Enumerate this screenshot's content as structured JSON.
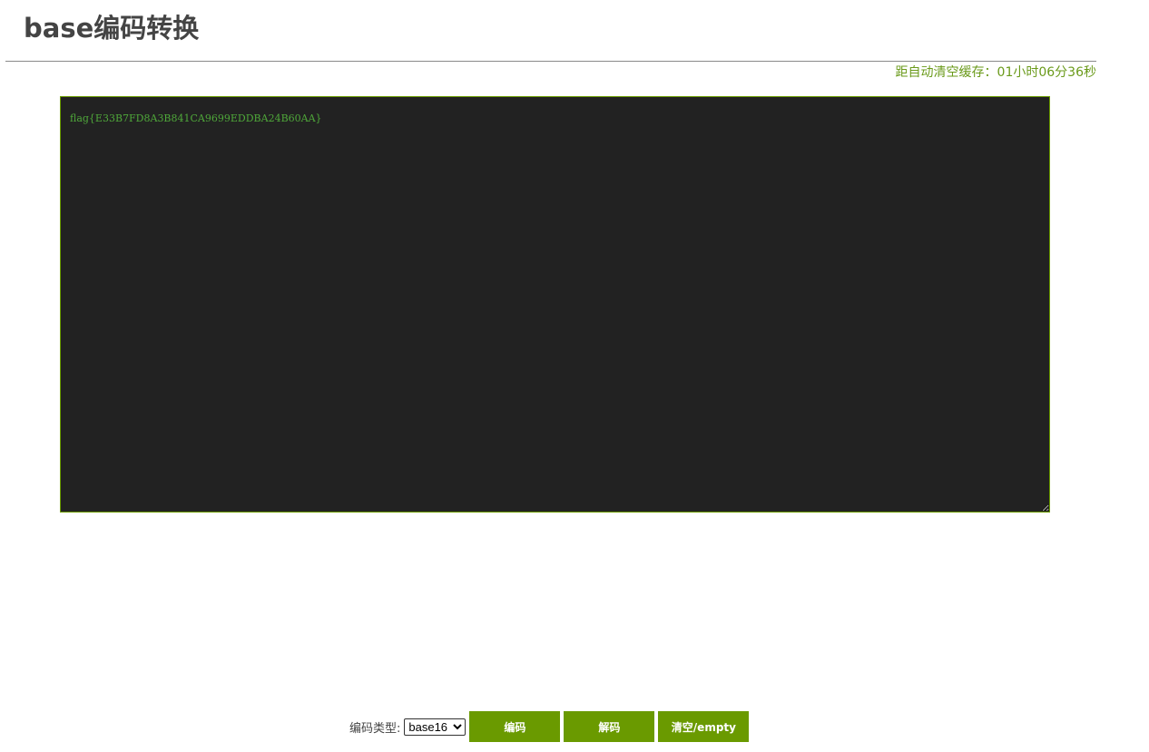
{
  "header": {
    "title": "base编码转换"
  },
  "timer": {
    "text": "距自动清空缓存：01小时06分36秒"
  },
  "editor": {
    "value": "flag{E33B7FD8A3B841CA9699EDDBA24B60AA}"
  },
  "controls": {
    "type_label": "编码类型:",
    "type_selected": "base16",
    "encode_label": "编码",
    "decode_label": "解码",
    "clear_label": "清空/empty"
  },
  "colors": {
    "accent": "#6a9a00",
    "editor_bg": "#222222",
    "editor_text": "#4fa83a",
    "title_text": "#444444"
  }
}
